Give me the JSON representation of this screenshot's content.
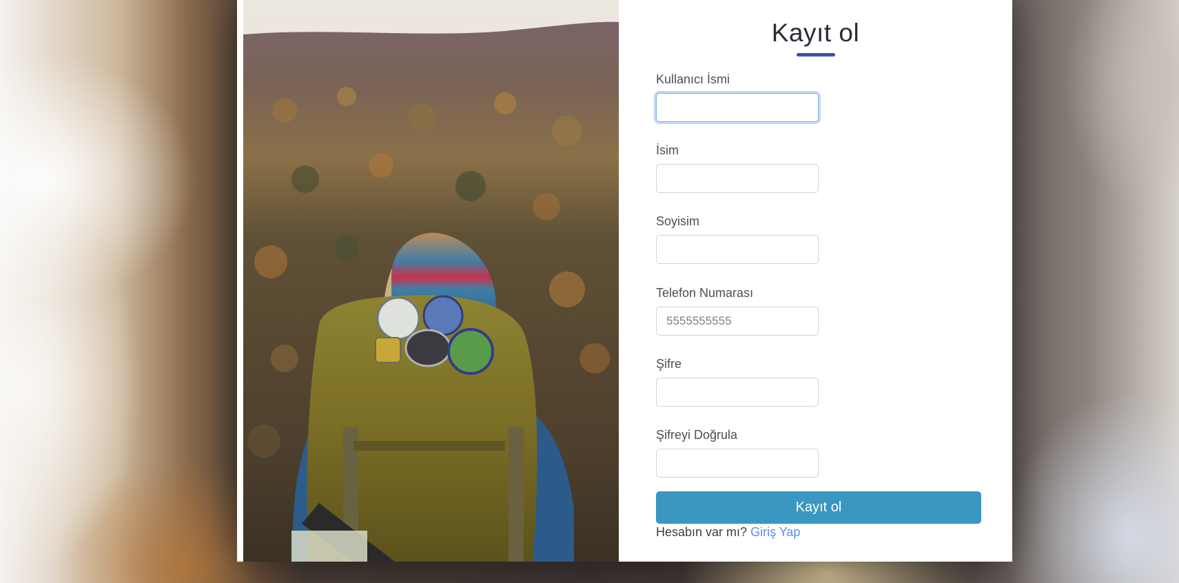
{
  "form": {
    "title": "Kayıt ol",
    "fields": [
      {
        "label": "Kullanıcı İsmi",
        "placeholder": "",
        "focused": true
      },
      {
        "label": "İsim",
        "placeholder": ""
      },
      {
        "label": "Soyisim",
        "placeholder": ""
      },
      {
        "label": "Telefon Numarası",
        "placeholder": "5555555555"
      },
      {
        "label": "Şifre",
        "placeholder": ""
      },
      {
        "label": "Şifreyi Doğrula",
        "placeholder": ""
      }
    ],
    "submit_label": "Kayıt ol",
    "login_prompt": "Hesabın var mı?",
    "login_link": "Giriş Yap"
  },
  "colors": {
    "accent": "#3c4fb0",
    "button": "#3a97c2",
    "link": "#5b8de8"
  }
}
